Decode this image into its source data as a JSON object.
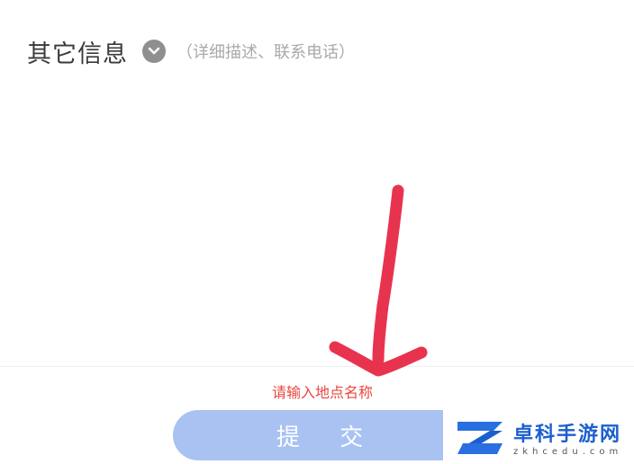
{
  "section": {
    "title": "其它信息",
    "hint": "（详细描述、联系电话）",
    "icon": "chevron-down-icon"
  },
  "form": {
    "validation_message": "请输入地点名称",
    "submit_label": "提 交"
  },
  "annotation": {
    "arrow_color": "#e8334f"
  },
  "watermark": {
    "name": "卓科手游网",
    "domain": "zkhcedu.com"
  },
  "colors": {
    "submit_disabled_bg": "#a9c2f2",
    "error_text": "#e8473f",
    "watermark_blue": "#1b5fcf"
  }
}
